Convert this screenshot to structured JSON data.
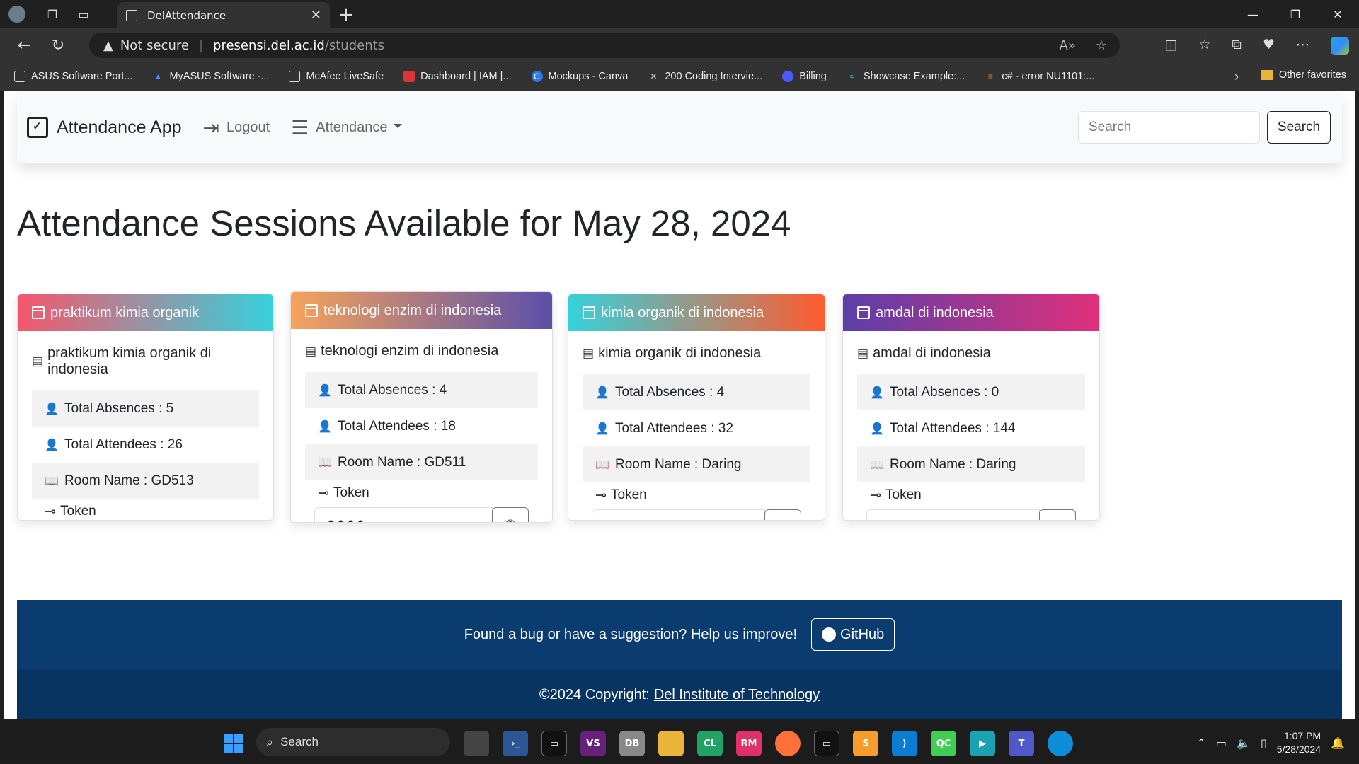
{
  "browser": {
    "tab_title": "DelAttendance",
    "url_warning": "Not secure",
    "url_host": "presensi.del.ac.id",
    "url_path": "/students",
    "bookmarks": [
      {
        "label": "ASUS Software Port...",
        "icon": "page-icon"
      },
      {
        "label": "MyASUS Software -...",
        "icon": "asus-icon"
      },
      {
        "label": "McAfee LiveSafe",
        "icon": "page-icon"
      },
      {
        "label": "Dashboard | IAM |...",
        "icon": "iam-icon"
      },
      {
        "label": "Mockups - Canva",
        "icon": "canva-icon"
      },
      {
        "label": "200 Coding Intervie...",
        "icon": "x-icon"
      },
      {
        "label": "Billing",
        "icon": "billing-icon"
      },
      {
        "label": "Showcase Example:...",
        "icon": "wave-icon"
      },
      {
        "label": "c# - error NU1101:...",
        "icon": "stack-icon"
      }
    ],
    "other_favorites": "Other favorites"
  },
  "navbar": {
    "brand": "Attendance App",
    "logout": "Logout",
    "attendance": "Attendance",
    "search_placeholder": "Search",
    "search_button": "Search"
  },
  "page": {
    "title": "Attendance Sessions Available for May 28, 2024"
  },
  "cards": [
    {
      "header": "praktikum kimia organik",
      "subtitle": "praktikum kimia organik di indonesia",
      "absences": "Total Absences : 5",
      "attendees": "Total Attendees : 26",
      "room": "Room Name : GD513",
      "token_label": "Token",
      "token_value": "••••"
    },
    {
      "header": "teknologi enzim di indonesia",
      "subtitle": "teknologi enzim di indonesia",
      "absences": "Total Absences : 4",
      "attendees": "Total Attendees : 18",
      "room": "Room Name : GD511",
      "token_label": "Token",
      "token_value": "••••"
    },
    {
      "header": "kimia organik di indonesia",
      "subtitle": "kimia organik di indonesia",
      "absences": "Total Absences : 4",
      "attendees": "Total Attendees : 32",
      "room": "Room Name : Daring",
      "token_label": "Token",
      "token_value": "••••"
    },
    {
      "header": "amdal di indonesia",
      "subtitle": "amdal di indonesia",
      "absences": "Total Absences : 0",
      "attendees": "Total Attendees : 144",
      "room": "Room Name : Daring",
      "token_label": "Token",
      "token_value": "••••"
    }
  ],
  "footer": {
    "message": "Found a bug or have a suggestion? Help us improve!",
    "github": "GitHub",
    "copyright": "©2024 Copyright:",
    "institute": "Del Institute of Technology"
  },
  "taskbar": {
    "search": "Search",
    "time": "1:07 PM",
    "date": "5/28/2024"
  },
  "colors": {
    "card_gradients": [
      "#f5576c→#36d1dc",
      "#f7a35c→#5b4fa8",
      "#36d1dc→#ff5b2e",
      "#5b3fa8→#e0307a"
    ],
    "footer_bg": "#0a3c70"
  }
}
